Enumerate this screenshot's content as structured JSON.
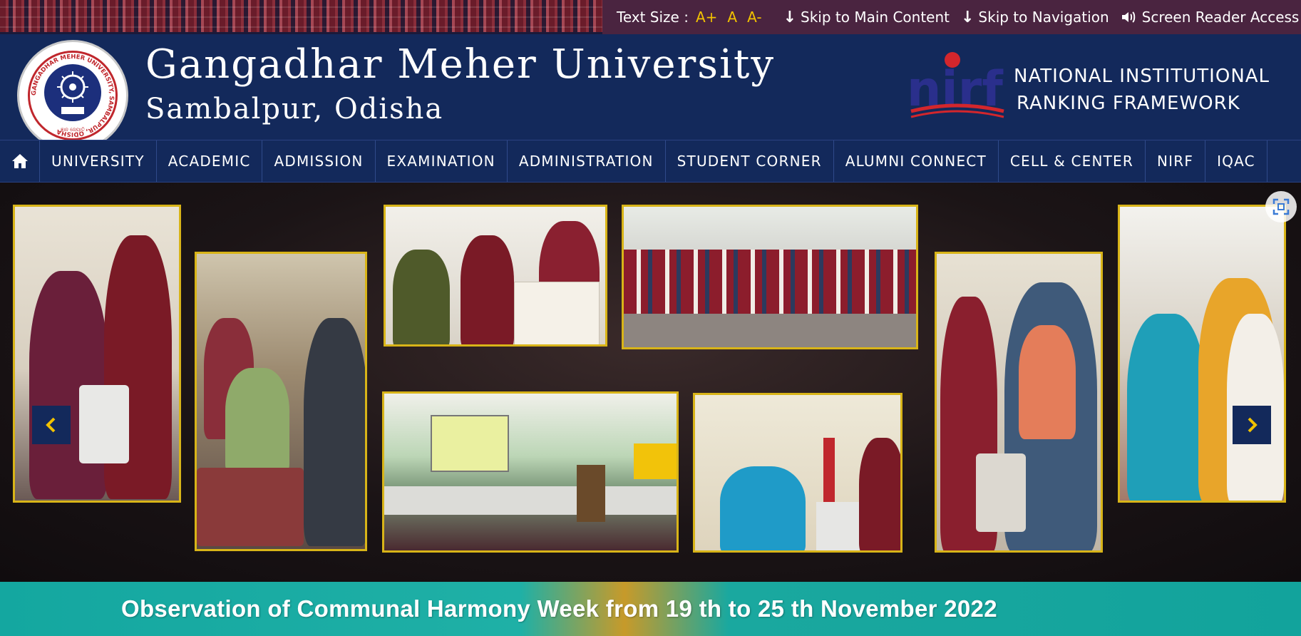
{
  "utility": {
    "text_size_label": "Text Size :",
    "text_size_options": [
      "A+",
      "A",
      "A-"
    ],
    "skip_main": "Skip to Main Content",
    "skip_nav": "Skip to Navigation",
    "screen_reader": "Screen Reader Access"
  },
  "header": {
    "title": "Gangadhar Meher University",
    "subtitle": "Sambalpur, Odisha",
    "logo_text": "GANGADHAR MEHER UNIVERSITY, SAMBALPUR, ODISHA",
    "nirf_logo_text": "nirf",
    "nirf_line1": "NATIONAL INSTITUTIONAL",
    "nirf_line2": "RANKING FRAMEWORK"
  },
  "nav": {
    "home_icon": "home-icon",
    "items": [
      "UNIVERSITY",
      "ACADEMIC",
      "ADMISSION",
      "EXAMINATION",
      "ADMINISTRATION",
      "STUDENT CORNER",
      "ALUMNI CONNECT",
      "CELL & CENTER",
      "NIRF",
      "IQAC"
    ]
  },
  "slider": {
    "prev_icon": "chevron-left-icon",
    "next_icon": "chevron-right-icon",
    "fullscreen_icon": "fullscreen-icon",
    "banner_text": "Observation of Communal Harmony Week from 19 th to 25 th November 2022"
  },
  "colors": {
    "navy": "#13295b",
    "gold": "#f2c200",
    "banner_teal": "#14a7a0",
    "frame_gold": "#d8b418"
  }
}
